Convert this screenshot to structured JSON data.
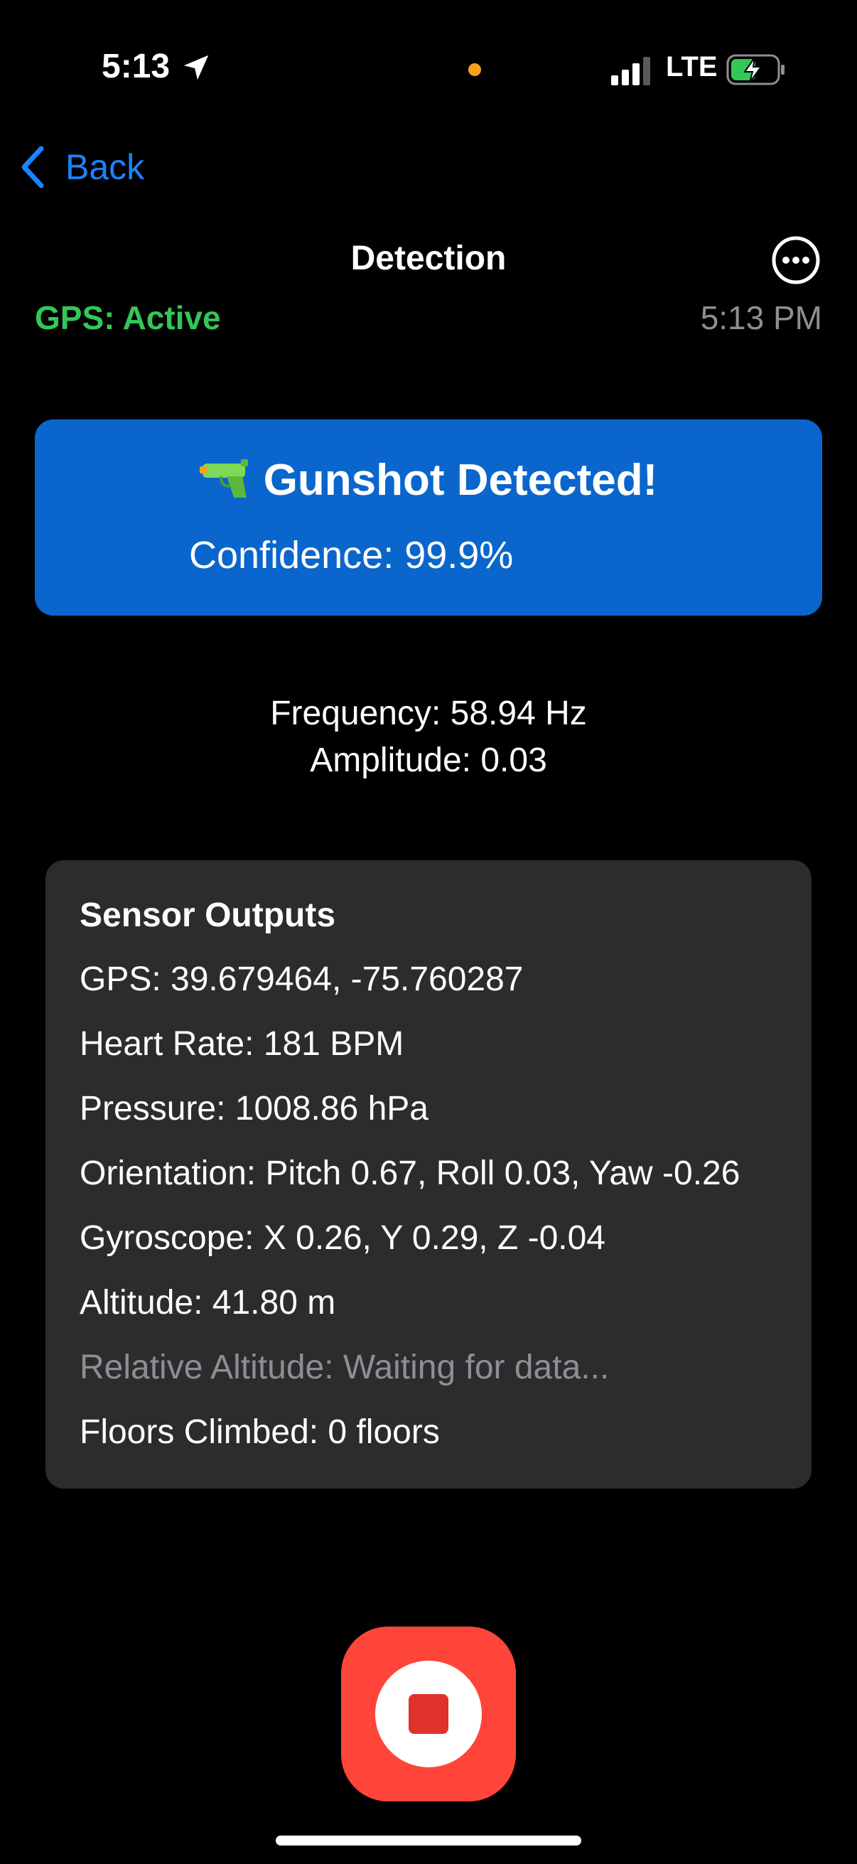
{
  "status_bar": {
    "time": "5:13",
    "network": "LTE",
    "location_icon": "location-arrow-icon",
    "signal_icon": "cellular-signal-icon",
    "battery_icon": "battery-charging-icon",
    "dot_color": "#f7a319"
  },
  "nav": {
    "back_label": "Back",
    "title": "Detection",
    "more_icon": "more-ellipsis-icon"
  },
  "gps_status": "GPS: Active",
  "current_time": "5:13 PM",
  "detection": {
    "icon": "water-pistol-icon",
    "title": "Gunshot Detected!",
    "confidence": "Confidence: 99.9%",
    "card_color": "#0a66cc"
  },
  "audio": {
    "frequency": "Frequency: 58.94 Hz",
    "amplitude": "Amplitude: 0.03"
  },
  "sensors": {
    "heading": "Sensor Outputs",
    "lines": [
      "GPS: 39.679464, -75.760287",
      "Heart Rate: 181 BPM",
      "Pressure: 1008.86 hPa",
      "Orientation: Pitch 0.67, Roll 0.03, Yaw -0.26",
      "Gyroscope: X 0.26, Y 0.29, Z -0.04",
      "Altitude: 41.80 m",
      "Relative Altitude: Waiting for data...",
      "Floors Climbed: 0 floors"
    ]
  },
  "stop_button": {
    "icon": "stop-icon",
    "color": "#ff453a"
  }
}
